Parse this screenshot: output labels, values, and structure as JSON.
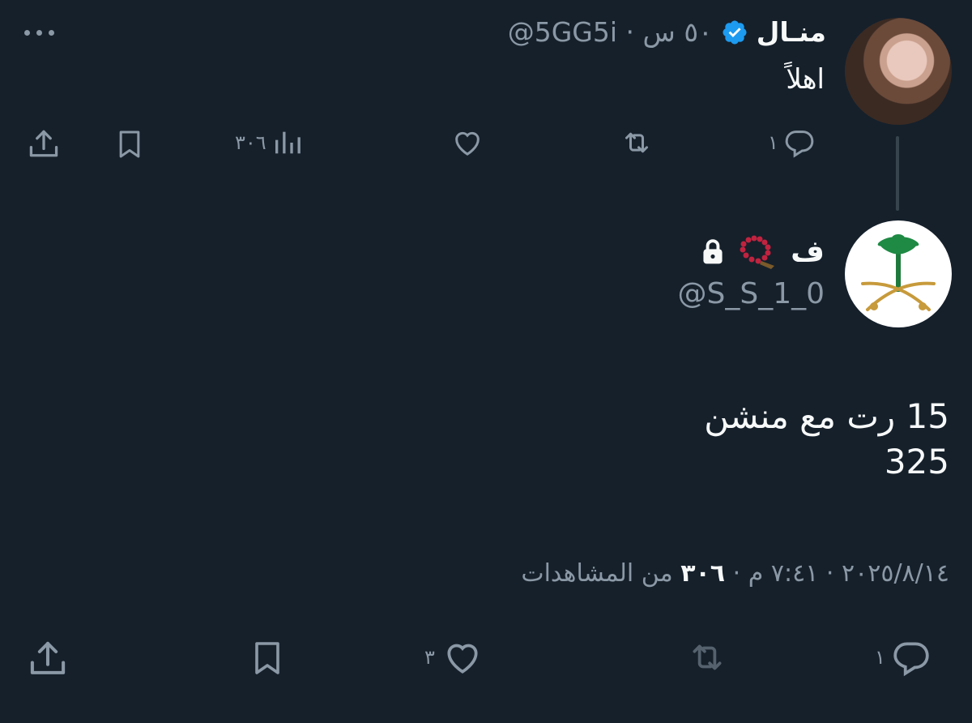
{
  "parent_tweet": {
    "name": "منـال",
    "handle": "@5GG5i",
    "time_ago": "٥٠ س",
    "separator": "·",
    "text": "اهلاً",
    "actions": {
      "replies": "١",
      "views": "٣٠٦"
    }
  },
  "main_tweet": {
    "name": "ف",
    "handle": "@S_S_1_0",
    "text_line1": "15 رت مع منشن",
    "text_line2": "325",
    "date": "٢٠٢٥/٨/١٤",
    "time": "٧:٤١ م",
    "views_count": "٣٠٦",
    "views_label": "من المشاهدات",
    "separator": "·",
    "actions": {
      "replies": "١",
      "likes": "٣"
    }
  },
  "colors": {
    "background": "#15202b",
    "text_primary": "#f7f9f9",
    "text_secondary": "#8b98a5",
    "verified": "#1d9bf0",
    "thread_line": "#38444d"
  },
  "icons": {
    "more": "more-icon",
    "reply": "reply-icon",
    "retweet": "retweet-icon",
    "like": "heart-icon",
    "views": "views-icon",
    "bookmark": "bookmark-icon",
    "share": "share-icon",
    "verified": "verified-icon",
    "lock": "lock-icon"
  }
}
